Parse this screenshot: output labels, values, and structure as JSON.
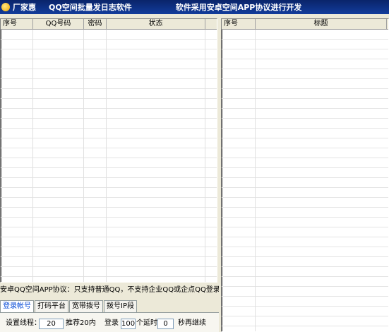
{
  "title_bar": {
    "brand": "厂家惠",
    "app_name": "QQ空间批量发日志软件",
    "tagline": "软件采用安卓空间APP协议进行开发"
  },
  "accounts_table": {
    "columns": [
      "序号",
      "QQ号码",
      "密码",
      "状态"
    ]
  },
  "posts_table": {
    "columns": [
      "序号",
      "标题"
    ]
  },
  "notice": "安卓QQ空间APP协议：只支持普通QQ，不支持企业QQ或企点QQ登录的！",
  "tabs": [
    "登录帐号",
    "打码平台",
    "宽带拨号",
    "拨号IP段"
  ],
  "active_tab": "登录帐号",
  "login_settings": {
    "threads_label": "设置线程：",
    "threads_value": "20",
    "threads_hint": "推荐20内",
    "login_label": "登录",
    "login_count": "100",
    "delay_label": "个延时",
    "delay_value": "0",
    "continue_label": "秒再继续"
  }
}
